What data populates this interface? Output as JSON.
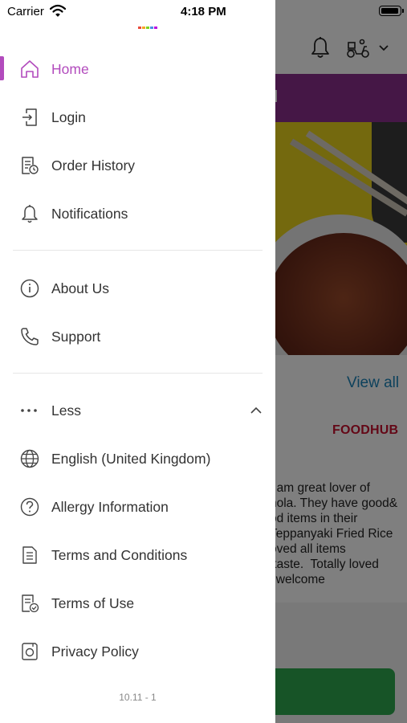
{
  "status_bar": {
    "carrier": "Carrier",
    "time": "4:18 PM"
  },
  "background": {
    "banner_text": "ed",
    "view_all": "View all",
    "brand": "FOODHUB",
    "review_text": "I am great lover of\nhola. They have good&\nod items in their\nTeppanyaki Fried Rice\noved all items\n taste.  Totally loved\nl welcome"
  },
  "menu": {
    "primary": [
      {
        "label": "Home",
        "icon": "home-icon",
        "active": true
      },
      {
        "label": "Login",
        "icon": "login-icon"
      },
      {
        "label": "Order History",
        "icon": "order-history-icon"
      },
      {
        "label": "Notifications",
        "icon": "bell-icon"
      }
    ],
    "secondary": [
      {
        "label": "About Us",
        "icon": "info-icon"
      },
      {
        "label": "Support",
        "icon": "phone-icon"
      }
    ],
    "more": {
      "label": "Less",
      "icon": "more-dots-icon"
    },
    "tertiary": [
      {
        "label": "English (United Kingdom)",
        "icon": "globe-icon"
      },
      {
        "label": "Allergy Information",
        "icon": "question-icon"
      },
      {
        "label": "Terms and Conditions",
        "icon": "document-icon"
      },
      {
        "label": "Terms of Use",
        "icon": "document-check-icon"
      },
      {
        "label": "Privacy Policy",
        "icon": "privacy-icon"
      }
    ]
  },
  "version": "10.11 - 1",
  "colors": {
    "accent": "#b24bbd",
    "banner": "#8b2f8d",
    "link": "#1a83b8",
    "cta": "#2fa84f"
  }
}
